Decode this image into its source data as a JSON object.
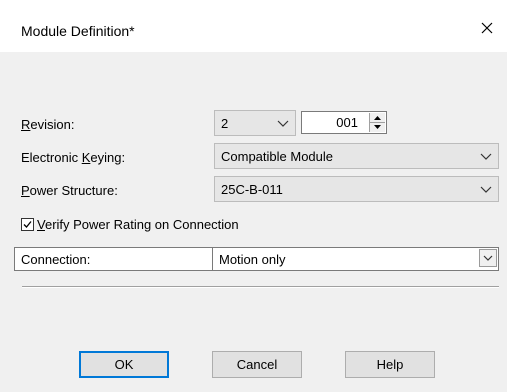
{
  "dialog": {
    "title": "Module Definition*",
    "close_icon": "close-icon"
  },
  "revision": {
    "label_pre": "",
    "label_accel": "R",
    "label_post": "evision:",
    "major": "2",
    "minor": "001"
  },
  "keying": {
    "label_pre": "Electronic ",
    "label_accel": "K",
    "label_post": "eying:",
    "value": "Compatible Module"
  },
  "power_structure": {
    "label_pre": "",
    "label_accel": "P",
    "label_post": "ower Structure:",
    "value": "25C-B-011"
  },
  "verify": {
    "label_pre": "",
    "label_accel": "V",
    "label_post": "erify Power Rating on Connection",
    "checked": true
  },
  "connection": {
    "label": "Connection:",
    "value": "Motion only"
  },
  "buttons": {
    "ok": "OK",
    "cancel": "Cancel",
    "help": "Help"
  }
}
